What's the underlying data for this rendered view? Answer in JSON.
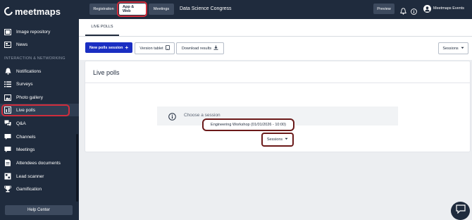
{
  "app": {
    "logo_text": "meetmaps"
  },
  "sidebar": {
    "items_top": [
      {
        "label": "Image repository",
        "icon": "image-icon"
      },
      {
        "label": "News",
        "icon": "news-icon"
      }
    ],
    "section_label": "INTERACTION & NETWORKING",
    "items": [
      {
        "label": "Notifications",
        "icon": "bell-icon"
      },
      {
        "label": "Surveys",
        "icon": "list-icon"
      },
      {
        "label": "Photo gallery",
        "icon": "photo-icon"
      },
      {
        "label": "Live polls",
        "icon": "poll-icon",
        "active": true
      },
      {
        "label": "Q&A",
        "icon": "qa-icon"
      },
      {
        "label": "Channels",
        "icon": "channels-icon"
      },
      {
        "label": "Meetings",
        "icon": "meetings-icon"
      },
      {
        "label": "Attendees documents",
        "icon": "document-icon"
      },
      {
        "label": "Lead scanner",
        "icon": "scanner-icon"
      },
      {
        "label": "Gamification",
        "icon": "trophy-icon"
      }
    ],
    "help_label": "Help Center"
  },
  "topbar": {
    "tabs": [
      "Registration",
      "App & Web",
      "Meetings"
    ],
    "event_title": "Data Science Congress",
    "preview_label": "Preview",
    "account_name": "Meetmaps Events"
  },
  "content": {
    "tab_label": "LIVE POLLS",
    "new_session_label": "New polls session",
    "version_tablet_label": "Version tablet",
    "download_label": "Download results",
    "sessions_label": "Sessions",
    "panel_title": "Live polls",
    "choose_session_text": "Choose a session",
    "selected_session": "Engineering Workshop (01/01/2026 - 10:00)",
    "sessions_dropdown_label": "Sessions"
  },
  "colors": {
    "sidebar_bg": "#1f2b3d",
    "primary_button": "#1a2ec2",
    "highlight_red": "#d02d3c",
    "highlight_brown": "#6b1a1a"
  }
}
